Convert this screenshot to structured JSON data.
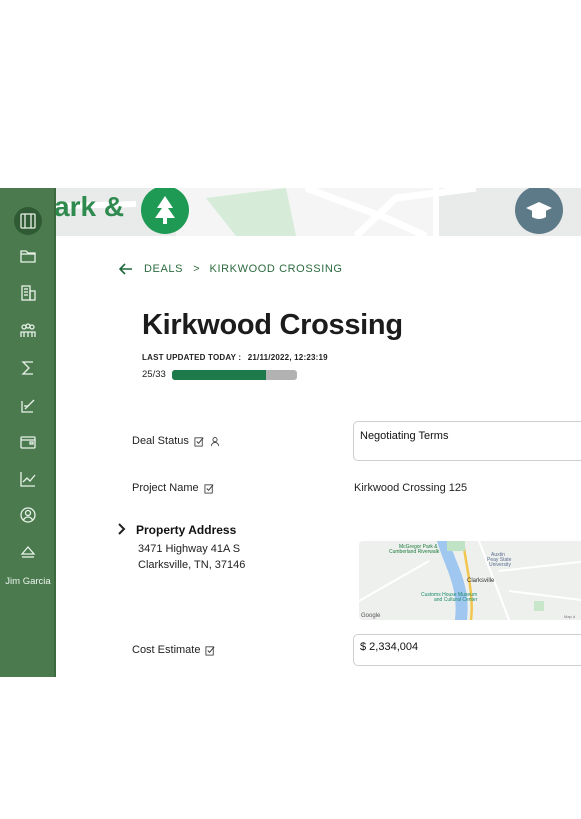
{
  "sidebar": {
    "items": [
      {
        "icon": "dashboard-icon",
        "active": true
      },
      {
        "icon": "folder-icon"
      },
      {
        "icon": "building-icon"
      },
      {
        "icon": "team-icon"
      },
      {
        "icon": "sigma-icon"
      },
      {
        "icon": "edit-document-icon"
      },
      {
        "icon": "wallet-icon"
      },
      {
        "icon": "trend-chart-icon"
      },
      {
        "icon": "user-circle-icon"
      },
      {
        "icon": "eject-icon"
      }
    ],
    "user_name": "Jim Garcia"
  },
  "breadcrumb": {
    "section": "DEALS",
    "separator": ">",
    "current": "KIRKWOOD CROSSING"
  },
  "page": {
    "title": "Kirkwood Crossing",
    "last_updated_label": "LAST UPDATED TODAY :",
    "last_updated_value": "21/11/2022, 12:23:19",
    "progress_text": "25/33",
    "progress_fraction": 0.7576
  },
  "fields": {
    "deal_status_label": "Deal Status",
    "deal_status_value": "Negotiating Terms",
    "project_name_label": "Project Name",
    "project_name_value": "Kirkwood Crossing 125",
    "property_address_label": "Property Address",
    "address_line1": "3471 Highway 41A S",
    "address_line2": "Clarksville, TN, 37146",
    "cost_estimate_label": "Cost Estimate",
    "cost_estimate_value": "$ 2,334,004"
  },
  "banner_text": "ark &",
  "map": {
    "poi1": "McGregor Park &",
    "poi1b": "Cumberland Riverwalk",
    "poi2": "Austin",
    "poi2b": "Peay State",
    "poi2c": "University",
    "city": "Clarksville",
    "poi3": "Customs House Museum",
    "poi3b": "and Cultural Center",
    "brand": "Google",
    "credit": "Map d"
  },
  "colors": {
    "sidebar": "#4a7a4e",
    "accent": "#1e7a4a",
    "breadcrumb": "#2c6b3f"
  }
}
